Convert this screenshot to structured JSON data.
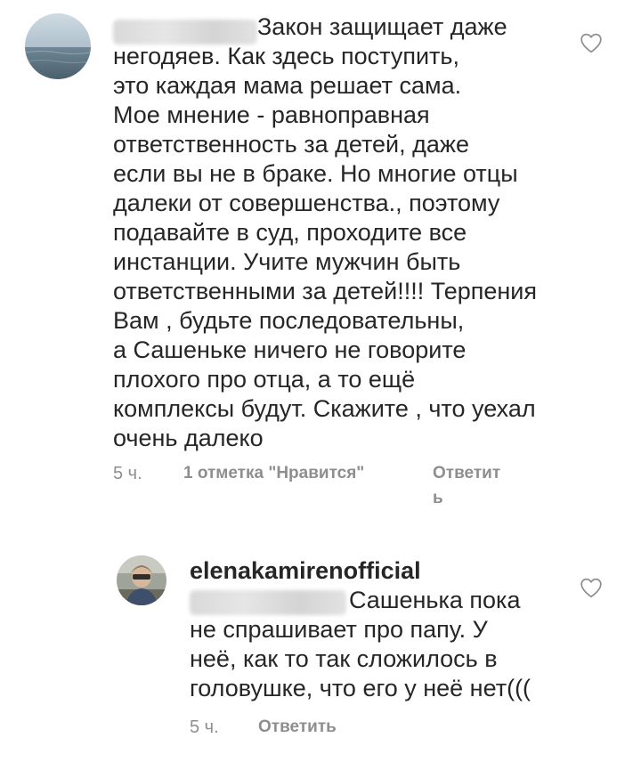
{
  "comment1": {
    "first_line": "Закон защищает даже",
    "body": "негодяев. Как здесь поступить,\nэто каждая мама решает сама.\nМое мнение - равноправная\nответственность за детей, даже\nесли вы не в браке. Но многие отцы\nдалеки от совершенства., поэтому\nподавайте в суд, проходите все\nинстанции. Учите мужчин быть\nответственными за детей!!!! Терпения\nВам , будьте последовательны,\nа Сашеньке ничего не говорите\nплохого про отца, а то ещё\nкомплексы будут. Скажите , что уехал\nочень далеко",
    "time": "5 ч.",
    "likes": "1 отметка \"Нравится\"",
    "reply_line1": "Ответит",
    "reply_line2": "ь"
  },
  "comment2": {
    "username": "elenakamirenofficial",
    "first_line": "Сашенька пока",
    "body": "не спрашивает про папу. У\nнеё, как то так сложилось в\nголовушке, что его у неё нет(((",
    "time": "5 ч.",
    "reply": "Ответить"
  },
  "icons": {
    "like": "heart-outline-icon",
    "avatar1": "sea-avatar",
    "avatar2": "person-avatar"
  },
  "colors": {
    "text": "#262626",
    "meta": "#8e8e8e",
    "background": "#ffffff"
  }
}
